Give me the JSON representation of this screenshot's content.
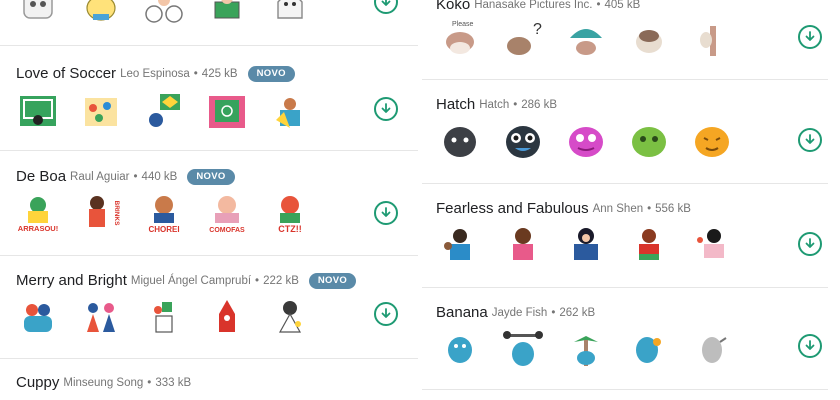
{
  "left_column": [
    {
      "id": "top-pack",
      "title": "",
      "author": "",
      "size": "",
      "stickers": [
        "sticker-robot",
        "sticker-yellow-bird",
        "sticker-bike",
        "sticker-reader",
        "sticker-gray-ghost"
      ],
      "download_icon": "download-icon"
    },
    {
      "id": "love-of-soccer",
      "title": "Love of Soccer",
      "author": "Leo Espinosa",
      "size": "425 kB",
      "badge": "NOVO",
      "stickers": [
        "sticker-soccer-goal",
        "sticker-soccer-fans",
        "sticker-soccer-flag",
        "sticker-soccer-field",
        "sticker-soccer-cheer"
      ],
      "download_icon": "download-icon"
    },
    {
      "id": "de-boa",
      "title": "De Boa",
      "author": "Raul Aguiar",
      "size": "440 kB",
      "badge": "NOVO",
      "stickers": [
        "sticker-arrasou",
        "sticker-brinks",
        "sticker-chorei",
        "sticker-comofas",
        "sticker-ctz"
      ],
      "sticker_texts": [
        "ARRASOU!",
        "BRINKS",
        "CHOREI",
        "COMOFAS",
        "CTZ!!"
      ],
      "download_icon": "download-icon"
    },
    {
      "id": "merry-and-bright",
      "title": "Merry and Bright",
      "author": "Miguel Ángel Camprubí",
      "size": "222 kB",
      "badge": "NOVO",
      "stickers": [
        "sticker-hug",
        "sticker-dance",
        "sticker-gift",
        "sticker-santa",
        "sticker-woman"
      ],
      "download_icon": "download-icon"
    },
    {
      "id": "cuppy",
      "title": "Cuppy",
      "author": "Minseung Song",
      "size": "333 kB",
      "stickers": []
    }
  ],
  "right_column": [
    {
      "id": "koko",
      "title": "Koko",
      "author": "Hanasake Pictures Inc.",
      "size": "405 kB",
      "stickers": [
        "sticker-koko-please",
        "sticker-koko-question",
        "sticker-koko-umbrella",
        "sticker-koko-sad",
        "sticker-koko-peek"
      ],
      "sticker_texts": [
        "Please",
        "?"
      ],
      "download_icon": "download-icon"
    },
    {
      "id": "hatch",
      "title": "Hatch",
      "author": "Hatch",
      "size": "286 kB",
      "stickers": [
        "sticker-hatch-black",
        "sticker-hatch-blue",
        "sticker-hatch-pink",
        "sticker-hatch-green",
        "sticker-hatch-orange"
      ],
      "download_icon": "download-icon"
    },
    {
      "id": "fearless-and-fabulous",
      "title": "Fearless and Fabulous",
      "author": "Ann Shen",
      "size": "556 kB",
      "stickers": [
        "sticker-woman-flex",
        "sticker-woman-pink",
        "sticker-woman-blue",
        "sticker-woman-dance",
        "sticker-woman-kiss"
      ],
      "download_icon": "download-icon"
    },
    {
      "id": "banana",
      "title": "Banana",
      "author": "Jayde Fish",
      "size": "262 kB",
      "stickers": [
        "sticker-banana-sit",
        "sticker-banana-lift",
        "sticker-banana-palm",
        "sticker-banana-dance",
        "sticker-banana-gray"
      ],
      "download_icon": "download-icon"
    }
  ],
  "colors": {
    "accent": "#1e9a73",
    "badge": "#5a8aa8",
    "divider": "#e6e6e6",
    "title": "#202124",
    "meta": "#757575"
  }
}
